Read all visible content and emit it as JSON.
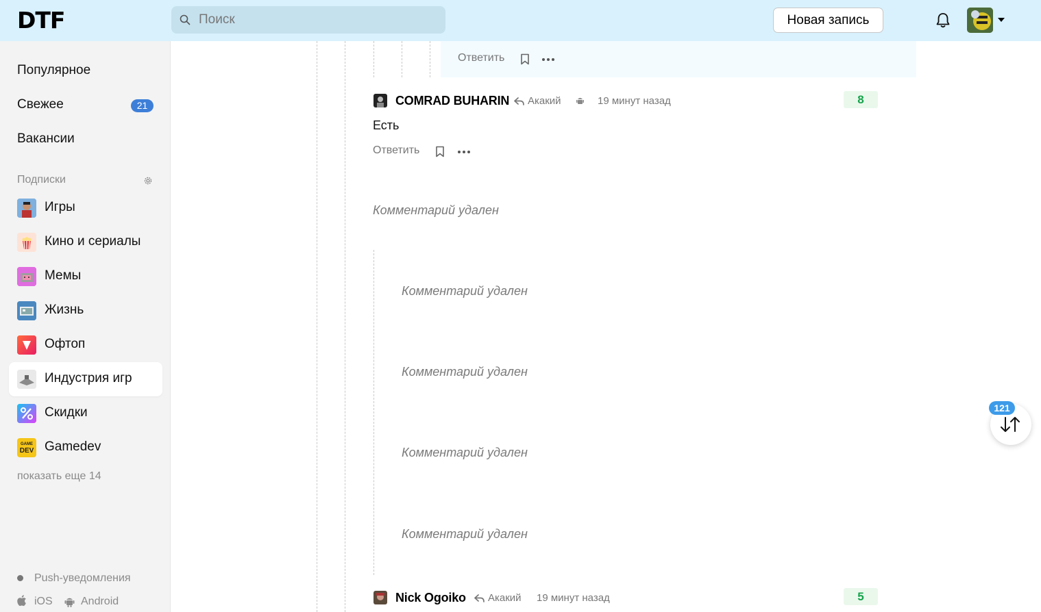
{
  "header": {
    "logo": "DTF",
    "search_placeholder": "Поиск",
    "new_post_label": "Новая запись"
  },
  "sidebar": {
    "nav": [
      {
        "label": "Популярное"
      },
      {
        "label": "Свежее",
        "badge": "21"
      },
      {
        "label": "Вакансии"
      }
    ],
    "subscriptions_title": "Подписки",
    "subscriptions": [
      {
        "label": "Игры",
        "icon": "games-icon"
      },
      {
        "label": "Кино и сериалы",
        "icon": "popcorn-icon"
      },
      {
        "label": "Мемы",
        "icon": "nyan-cat-icon"
      },
      {
        "label": "Жизнь",
        "icon": "life-icon"
      },
      {
        "label": "Офтоп",
        "icon": "offtop-icon"
      },
      {
        "label": "Индустрия игр",
        "icon": "industry-icon",
        "active": true
      },
      {
        "label": "Скидки",
        "icon": "percent-icon"
      },
      {
        "label": "Gamedev",
        "icon": "gamedev-icon",
        "icon_text_top": "GAME",
        "icon_text_bottom": "DEV"
      }
    ],
    "show_more": "показать еще 14",
    "push_label": "Push-уведомления",
    "ios_label": "iOS",
    "android_label": "Android"
  },
  "thread": {
    "prev_reply_label": "Ответить",
    "comment1": {
      "author": "COMRAD BUHARIN",
      "reply_to": "Акакий",
      "time": "19 минут назад",
      "score": "8",
      "text": "Есть",
      "reply_label": "Ответить"
    },
    "deleted_text": "Комментарий удален",
    "deleted_top": [
      "Комментарий удален"
    ],
    "deleted_nested": [
      "Комментарий удален",
      "Комментарий удален",
      "Комментарий удален",
      "Комментарий удален"
    ],
    "comment2": {
      "author": "Nick Ogoiko",
      "reply_to": "Акакий",
      "time": "19 минут назад",
      "score": "5"
    }
  },
  "scroll_button": {
    "count": "121"
  },
  "colors": {
    "header_bg": "#d8f1fd",
    "accent_blue": "#3d7fd8",
    "score_green": "#15a34a",
    "sidebar_bg": "#f3f3f3"
  }
}
